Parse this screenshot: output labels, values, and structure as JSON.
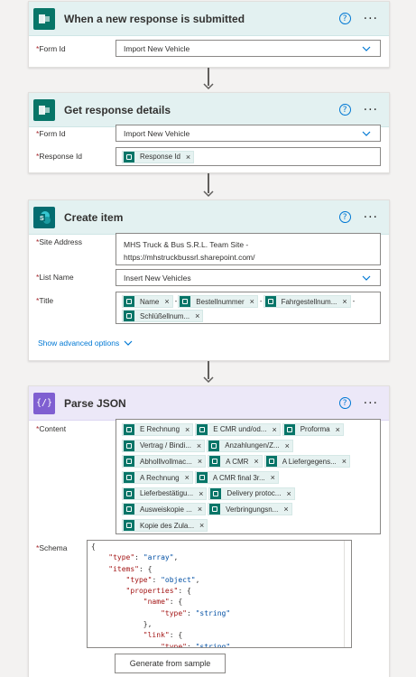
{
  "trigger": {
    "title": "When a new response is submitted",
    "form_id_label": "Form Id",
    "form_id_value": "Import New Vehicle"
  },
  "get_response": {
    "title": "Get response details",
    "form_id_label": "Form Id",
    "form_id_value": "Import New Vehicle",
    "response_id_label": "Response Id",
    "response_id_token": "Response Id"
  },
  "create_item": {
    "title": "Create item",
    "site_address_label": "Site Address",
    "site_address_line1": "MHS Truck &  Bus S.R.L. Team Site -",
    "site_address_line2": "https://mhstruckbussrl.sharepoint.com/",
    "list_name_label": "List Name",
    "list_name_value": "Insert New Vehicles",
    "title_label": "Title",
    "title_tokens": [
      "Name",
      "Bestellnummer",
      "Fahrgestellnum...",
      "Schlüßellnum..."
    ],
    "separator": "-",
    "advanced_link": "Show advanced options"
  },
  "parse_json": {
    "title": "Parse JSON",
    "content_label": "Content",
    "content_tokens": [
      [
        "E Rechnung",
        "E CMR und/od...",
        "Proforma"
      ],
      [
        "Vertrag / Bindi...",
        "Anzahlungen/Z..."
      ],
      [
        "Abholllvollmac...",
        "A CMR",
        "A Liefergegens..."
      ],
      [
        "A Rechnung",
        "A CMR final 3r..."
      ],
      [
        "Lieferbestätigu...",
        "Delivery protoc..."
      ],
      [
        "Ausweiskopie ...",
        "Verbringungsn..."
      ],
      [
        "Kopie des Zula..."
      ]
    ],
    "schema_label": "Schema",
    "schema_lines": [
      "{",
      "    \"type\": \"array\",",
      "    \"items\": {",
      "        \"type\": \"object\",",
      "        \"properties\": {",
      "            \"name\": {",
      "                \"type\": \"string\"",
      "            },",
      "            \"link\": {",
      "                \"type\": \"string\""
    ],
    "generate_button": "Generate from sample"
  },
  "icons": {
    "help": "help-icon",
    "more": "more-options-icon",
    "forms": "microsoft-forms-icon",
    "sharepoint": "sharepoint-icon",
    "json": "parse-json-icon"
  },
  "colors": {
    "forms_header": "#e3f1f1",
    "json_header": "#ece8f8",
    "accent": "#0078d4",
    "forms_brand": "#077568",
    "json_brand": "#7f5fd1"
  }
}
